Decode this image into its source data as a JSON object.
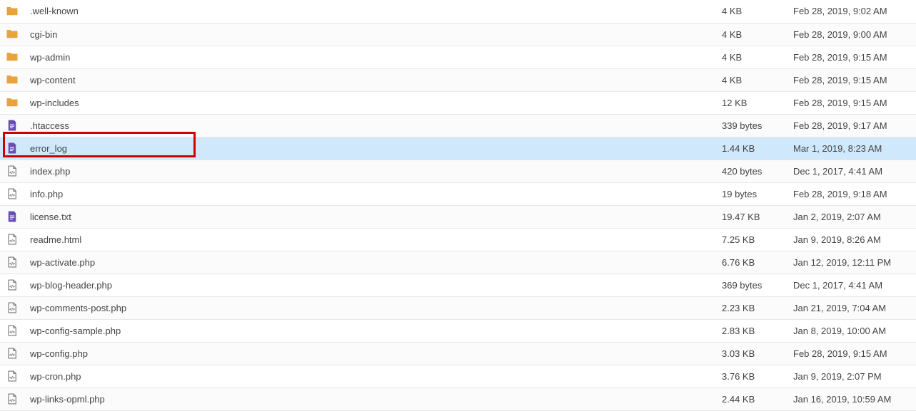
{
  "files": [
    {
      "icon": "folder",
      "name": ".well-known",
      "size": "4 KB",
      "date": "Feb 28, 2019, 9:02 AM",
      "selected": false
    },
    {
      "icon": "folder",
      "name": "cgi-bin",
      "size": "4 KB",
      "date": "Feb 28, 2019, 9:00 AM",
      "selected": false
    },
    {
      "icon": "folder",
      "name": "wp-admin",
      "size": "4 KB",
      "date": "Feb 28, 2019, 9:15 AM",
      "selected": false
    },
    {
      "icon": "folder",
      "name": "wp-content",
      "size": "4 KB",
      "date": "Feb 28, 2019, 9:15 AM",
      "selected": false
    },
    {
      "icon": "folder",
      "name": "wp-includes",
      "size": "12 KB",
      "date": "Feb 28, 2019, 9:15 AM",
      "selected": false
    },
    {
      "icon": "textfile",
      "name": ".htaccess",
      "size": "339 bytes",
      "date": "Feb 28, 2019, 9:17 AM",
      "selected": false
    },
    {
      "icon": "textfile",
      "name": "error_log",
      "size": "1.44 KB",
      "date": "Mar 1, 2019, 8:23 AM",
      "selected": true
    },
    {
      "icon": "php",
      "name": "index.php",
      "size": "420 bytes",
      "date": "Dec 1, 2017, 4:41 AM",
      "selected": false
    },
    {
      "icon": "php",
      "name": "info.php",
      "size": "19 bytes",
      "date": "Feb 28, 2019, 9:18 AM",
      "selected": false
    },
    {
      "icon": "textfile",
      "name": "license.txt",
      "size": "19.47 KB",
      "date": "Jan 2, 2019, 2:07 AM",
      "selected": false
    },
    {
      "icon": "php",
      "name": "readme.html",
      "size": "7.25 KB",
      "date": "Jan 9, 2019, 8:26 AM",
      "selected": false
    },
    {
      "icon": "php",
      "name": "wp-activate.php",
      "size": "6.76 KB",
      "date": "Jan 12, 2019, 12:11 PM",
      "selected": false
    },
    {
      "icon": "php",
      "name": "wp-blog-header.php",
      "size": "369 bytes",
      "date": "Dec 1, 2017, 4:41 AM",
      "selected": false
    },
    {
      "icon": "php",
      "name": "wp-comments-post.php",
      "size": "2.23 KB",
      "date": "Jan 21, 2019, 7:04 AM",
      "selected": false
    },
    {
      "icon": "php",
      "name": "wp-config-sample.php",
      "size": "2.83 KB",
      "date": "Jan 8, 2019, 10:00 AM",
      "selected": false
    },
    {
      "icon": "php",
      "name": "wp-config.php",
      "size": "3.03 KB",
      "date": "Feb 28, 2019, 9:15 AM",
      "selected": false
    },
    {
      "icon": "php",
      "name": "wp-cron.php",
      "size": "3.76 KB",
      "date": "Jan 9, 2019, 2:07 PM",
      "selected": false
    },
    {
      "icon": "php",
      "name": "wp-links-opml.php",
      "size": "2.44 KB",
      "date": "Jan 16, 2019, 10:59 AM",
      "selected": false
    }
  ]
}
